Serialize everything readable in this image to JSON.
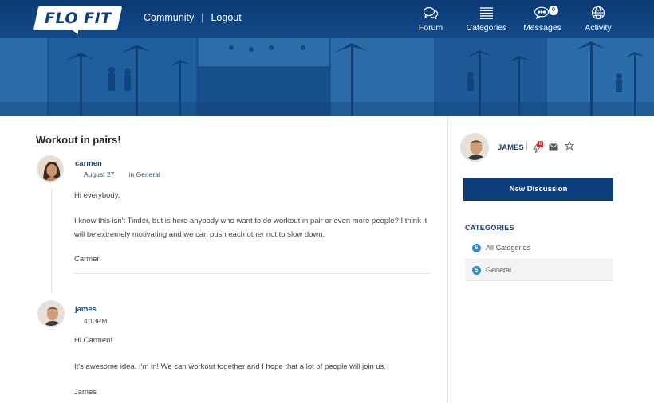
{
  "brand": {
    "logo_text": "FLO FIT",
    "primary_color": "#0d3f7c",
    "accent_color": "#2c8ec9"
  },
  "topbar": {
    "links": [
      {
        "label": "Community"
      },
      {
        "label": "Logout"
      }
    ],
    "nav": [
      {
        "label": "Forum",
        "icon": "chat-bubbles-icon"
      },
      {
        "label": "Categories",
        "icon": "list-icon"
      },
      {
        "label": "Messages",
        "icon": "message-bubble-icon",
        "badge": "0"
      },
      {
        "label": "Activity",
        "icon": "globe-icon"
      }
    ]
  },
  "discussion": {
    "title": "Workout in pairs!",
    "posts": [
      {
        "author": "carmen",
        "date": "August 27",
        "in_label": "in",
        "category": "General",
        "paragraphs": [
          "Hi everybody,",
          "I know this isn't Tinder, but is here anybody who want to do workout in pair or even more people? I think it will be extremely motivating and we can push each other not to slow down.",
          "Carmen"
        ]
      },
      {
        "author": "james",
        "date": "4:13PM",
        "paragraphs": [
          "Hi Carmen!",
          "It's awesome idea. I'm in! We can workout together and I hope that a lot of people will join us.",
          "James"
        ]
      }
    ]
  },
  "sidebar": {
    "user": {
      "name": "JAMES",
      "separator": "|",
      "notification_badge": "8"
    },
    "new_discussion_label": "New Discussion",
    "categories_heading": "CATEGORIES",
    "categories": [
      {
        "count": "5",
        "label": "All Categories"
      },
      {
        "count": "5",
        "label": "General"
      }
    ]
  }
}
